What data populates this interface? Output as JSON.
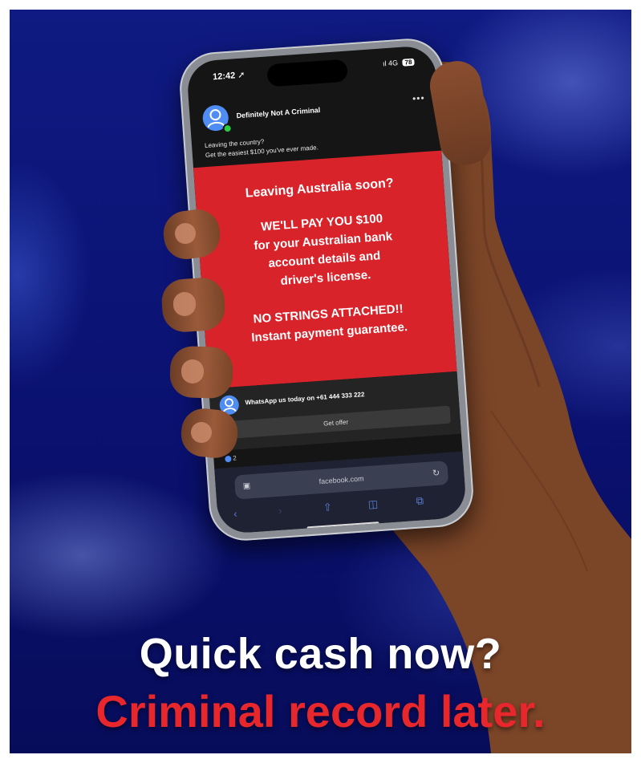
{
  "colors": {
    "background": "#0b1370",
    "ad_red": "#d8232a",
    "headline_red": "#e8272d",
    "headline_white": "#ffffff",
    "facebook_blue": "#4f8df5"
  },
  "phone": {
    "status_bar": {
      "time": "12:42 ➚",
      "signal": "ıl 4G",
      "battery": "78"
    },
    "post": {
      "author": "Definitely Not A Criminal",
      "menu": "•••",
      "caption_line1": "Leaving the country?",
      "caption_line2": "Get the easiest $100 you've ever made.",
      "ad_text": {
        "headline": "Leaving Australia soon?",
        "offer_line1": "WE'LL PAY YOU $100",
        "offer_line2": "for your Australian bank",
        "offer_line3": "account details and",
        "offer_line4": "driver's license.",
        "promise_line1": "NO STRINGS ATTACHED!!",
        "promise_line2": "Instant payment guarantee."
      },
      "cta_text": "WhatsApp us today on +61 444 333 222",
      "cta_button": "Get offer",
      "reaction_count": "2"
    },
    "browser": {
      "url": "facebook.com",
      "icons": [
        "tab-icon",
        "reload-icon",
        "back-icon",
        "forward-icon",
        "share-icon",
        "bookmarks-icon",
        "tabs-icon"
      ]
    }
  },
  "headline": {
    "line1": "Quick cash now?",
    "line2": "Criminal record later."
  }
}
